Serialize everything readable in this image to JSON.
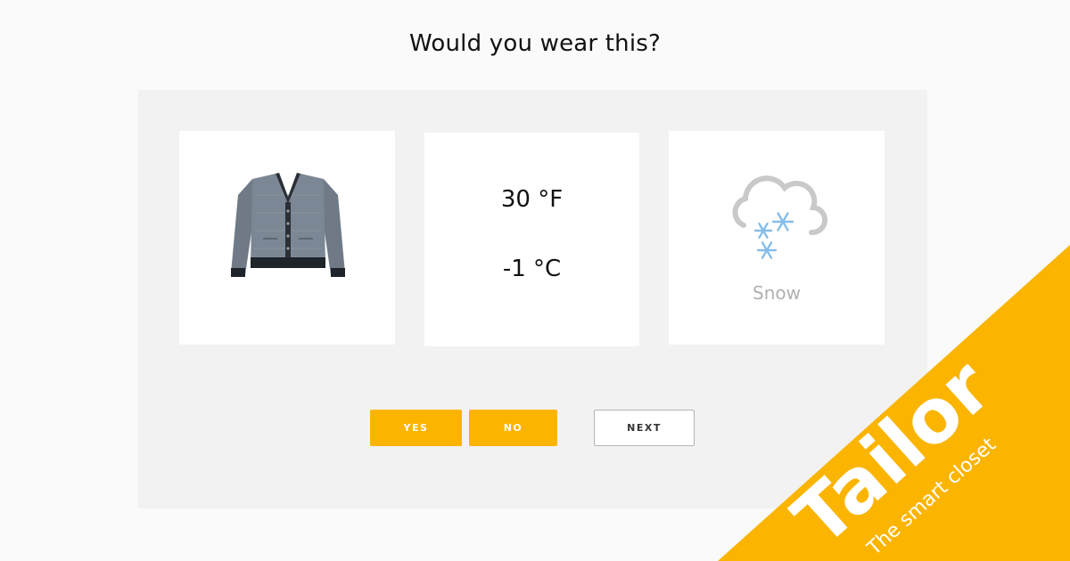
{
  "question": "Would you wear this?",
  "item": {
    "icon": "cardigan-icon"
  },
  "temperature": {
    "fahrenheit": "30 °F",
    "celsius": "-1 °C"
  },
  "weather": {
    "icon": "snow-cloud-icon",
    "label": "Snow"
  },
  "buttons": {
    "yes": "YES",
    "no": "NO",
    "next": "NEXT"
  },
  "brand": {
    "name": "Tailor",
    "tagline": "The smart closet",
    "color": "#fbb400"
  }
}
